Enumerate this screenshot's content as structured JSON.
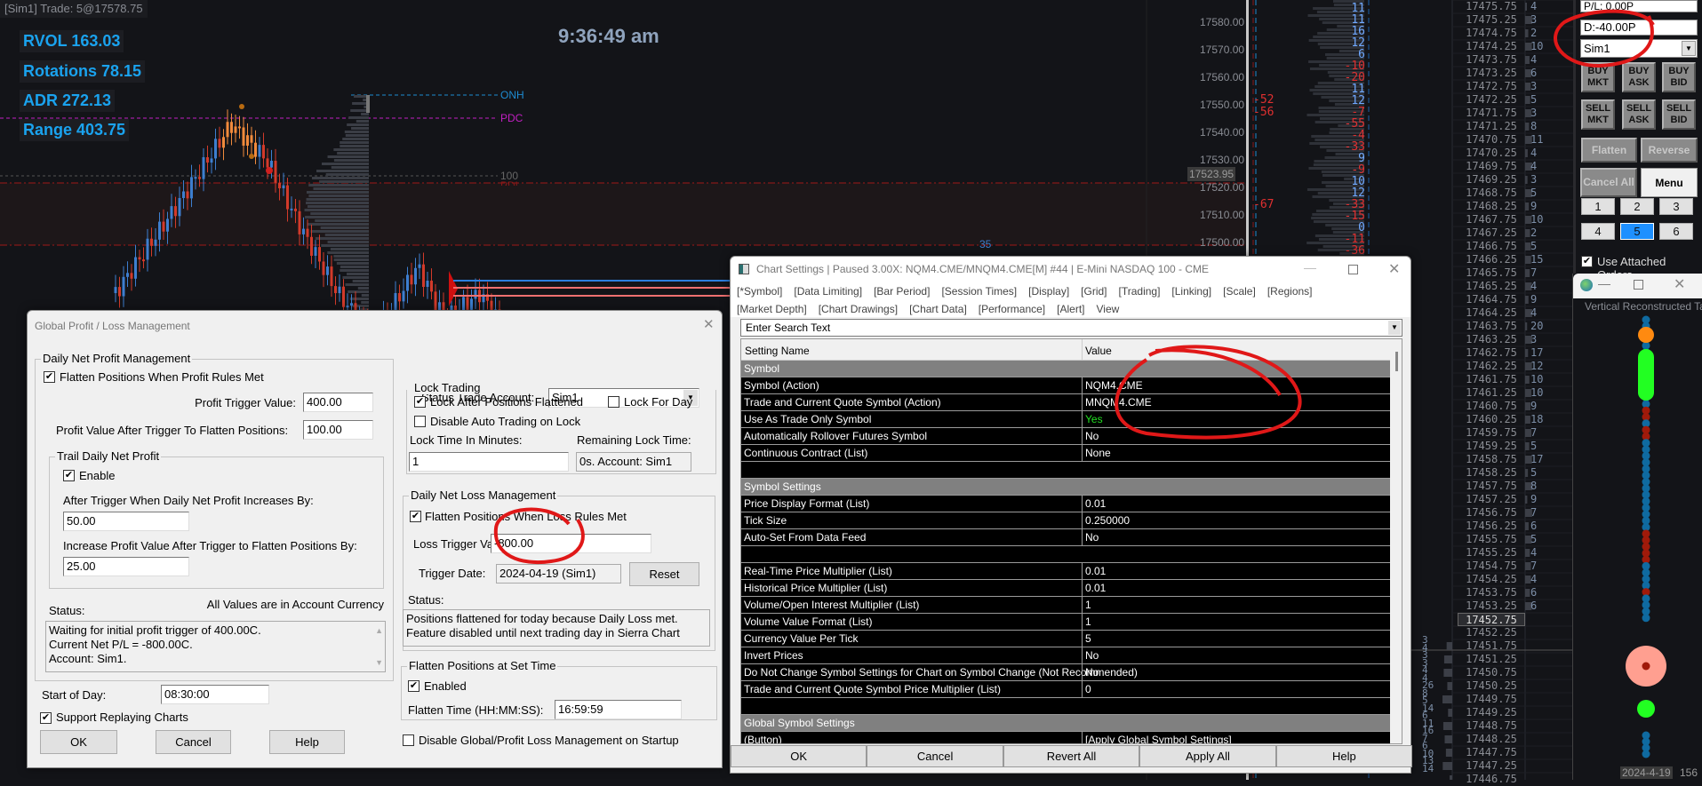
{
  "chart": {
    "top_label": "[Sim1]  Trade: 5@17578.75",
    "stats": [
      "RVOL 163.03",
      "Rotations 78.15",
      "ADR 272.13",
      "Range 403.75"
    ],
    "clock": "9:36:49 am",
    "levels": {
      "onh": "ONH",
      "pdc": "PDC",
      "hundred": "100",
      "pdl": "PDL"
    },
    "marker_label": "35",
    "price_axis": [
      "17580.00",
      "17570.00",
      "17560.00",
      "17550.00",
      "17540.00",
      "17530.00",
      "17520.00",
      "17510.00",
      "17500.00"
    ],
    "current_price": "17523.95",
    "colors": {
      "up": "#3d7ecf",
      "down": "#d23a2a",
      "peak": "#f08a3c",
      "stat": "#1aa3ef"
    }
  },
  "dom": {
    "left_deltas": [
      "-52",
      "-56",
      "-67"
    ],
    "deltas": [
      {
        "v": "11",
        "c": "#6fa8ff"
      },
      {
        "v": "11",
        "c": "#6fa8ff"
      },
      {
        "v": "16",
        "c": "#6fa8ff"
      },
      {
        "v": "12",
        "c": "#6fa8ff"
      },
      {
        "v": "6",
        "c": "#6fa8ff"
      },
      {
        "v": "-10",
        "c": "#e03030"
      },
      {
        "v": "-20",
        "c": "#e03030"
      },
      {
        "v": "11",
        "c": "#6fa8ff"
      },
      {
        "v": "12",
        "c": "#6fa8ff"
      },
      {
        "v": "-7",
        "c": "#e03030"
      },
      {
        "v": "-55",
        "c": "#e03030"
      },
      {
        "v": "-4",
        "c": "#e03030"
      },
      {
        "v": "-33",
        "c": "#e03030"
      },
      {
        "v": "9",
        "c": "#6fa8ff"
      },
      {
        "v": "-9",
        "c": "#e03030"
      },
      {
        "v": "10",
        "c": "#6fa8ff"
      },
      {
        "v": "12",
        "c": "#6fa8ff"
      },
      {
        "v": "-33",
        "c": "#e03030"
      },
      {
        "v": "-15",
        "c": "#e03030"
      },
      {
        "v": "0",
        "c": "#6fa8ff"
      },
      {
        "v": "-11",
        "c": "#e03030"
      },
      {
        "v": "-36",
        "c": "#e03030"
      }
    ],
    "lower_volumes": [
      "3",
      "4",
      "3",
      "3",
      "4",
      "4",
      "26",
      "8",
      "5",
      "14",
      "6",
      "11",
      "16",
      "7",
      "6",
      "10",
      "13",
      "14"
    ]
  },
  "ladder": {
    "prices": [
      "17475.75",
      "17475.25",
      "17474.75",
      "17474.25",
      "17473.75",
      "17473.25",
      "17472.75",
      "17472.25",
      "17471.75",
      "17471.25",
      "17470.75",
      "17470.25",
      "17469.75",
      "17469.25",
      "17468.75",
      "17468.25",
      "17467.75",
      "17467.25",
      "17466.75",
      "17466.25",
      "17465.75",
      "17465.25",
      "17464.75",
      "17464.25",
      "17463.75",
      "17463.25",
      "17462.75",
      "17462.25",
      "17461.75",
      "17461.25",
      "17460.75",
      "17460.25",
      "17459.75",
      "17459.25",
      "17458.75",
      "17458.25",
      "17457.75",
      "17457.25",
      "17456.75",
      "17456.25",
      "17455.75",
      "17455.25",
      "17454.75",
      "17454.25",
      "17453.75",
      "17453.25",
      "17452.75",
      "17452.25",
      "17451.75",
      "17451.25",
      "17450.75",
      "17450.25",
      "17449.75",
      "17449.25",
      "17448.75",
      "17448.25",
      "17447.75",
      "17447.25",
      "17446.75"
    ],
    "current_index": 46,
    "volumes": [
      "4",
      "3",
      "2",
      "10",
      "4",
      "6",
      "3",
      "5",
      "3",
      "8",
      "11",
      "4",
      "4",
      "3",
      "5",
      "9",
      "10",
      "2",
      "5",
      "15",
      "7",
      "4",
      "9",
      "4",
      "20",
      "3",
      "17",
      "12",
      "10",
      "10",
      "9",
      "18",
      "7",
      "5",
      "17",
      "5",
      "8",
      "9",
      "7",
      "6",
      "5",
      "4",
      "7",
      "4",
      "6",
      "6"
    ]
  },
  "trade_panel": {
    "pl": "P/L: 0.00P",
    "daily": "D:-40.00P",
    "account": "Sim1",
    "buy_mkt": "BUY MKT",
    "buy_ask": "BUY ASK",
    "buy_bid": "BUY BID",
    "sell_mkt": "SELL MKT",
    "sell_ask": "SELL ASK",
    "sell_bid": "SELL BID",
    "flatten": "Flatten",
    "reverse": "Reverse",
    "cancel_all": "Cancel All",
    "menu": "Menu",
    "qty": [
      "1",
      "2",
      "3",
      "4",
      "5",
      "6"
    ],
    "selected_qty": "5",
    "use_attached": "Use Attached Orders",
    "accent": "#1e90ff"
  },
  "tape": {
    "title": "Vertical Reconstructed Ta",
    "date": "2024-4-19",
    "count": "156"
  },
  "pl_dialog": {
    "title": "Global Profit / Loss Management",
    "profit_group": "Daily Net Profit Management",
    "flatten_profit": "Flatten Positions When Profit Rules Met",
    "profit_trigger_label": "Profit Trigger Value:",
    "profit_trigger": "400.00",
    "profit_after_label": "Profit Value After Trigger To Flatten Positions:",
    "profit_after": "100.00",
    "trail_group": "Trail Daily Net Profit",
    "enable": "Enable",
    "increase_by_label": "After Trigger When Daily Net Profit Increases By:",
    "increase_by": "50.00",
    "increase_value_label": "Increase Profit Value After Trigger to Flatten Positions By:",
    "increase_value": "25.00",
    "status_label": "Status:",
    "currency_note": "All Values are in Account Currency",
    "status_lines": [
      "Waiting for initial profit trigger of 400.00C.",
      "Current Net P/L = -800.00C.",
      "Account: Sim1."
    ],
    "start_label": "Start of Day:",
    "start": "08:30:00",
    "support_replay": "Support Replaying Charts",
    "ok": "OK",
    "cancel": "Cancel",
    "help": "Help",
    "status_account_label": "Status Trade Account:",
    "status_account": "Sim1",
    "lock_group": "Lock Trading",
    "lock_after": "Lock After Positions Flattened",
    "lock_day": "Lock For Day",
    "disable_auto": "Disable Auto Trading on Lock",
    "lock_time_label": "Lock Time In Minutes:",
    "lock_time": "1",
    "remaining_label": "Remaining Lock Time:",
    "remaining": "0s. Account: Sim1",
    "loss_group": "Daily Net Loss Management",
    "flatten_loss": "Flatten Positions When Loss Rules Met",
    "loss_trigger_label": "Loss Trigger Value:",
    "loss_trigger": "-800.00",
    "trigger_date_label": "Trigger Date:",
    "trigger_date": "2024-04-19 (Sim1)",
    "reset": "Reset",
    "loss_status_label": "Status:",
    "loss_status_lines": [
      "Positions flattened for today because Daily Loss met.",
      "Feature disabled until next trading day in Sierra Chart"
    ],
    "set_time_group": "Flatten Positions at Set Time",
    "enabled": "Enabled",
    "flatten_time_label": "Flatten Time (HH:MM:SS):",
    "flatten_time": "16:59:59",
    "disable_startup": "Disable Global/Profit Loss Management on Startup"
  },
  "cs_dialog": {
    "title": "Chart Settings | Paused 3.00X: NQM4.CME/MNQM4.CME[M] #44 | E-Mini NASDAQ 100 - CME",
    "tabs_row1": [
      "[*Symbol]",
      "[Data Limiting]",
      "[Bar Period]",
      "[Session Times]",
      "[Display]",
      "[Grid]",
      "[Trading]",
      "[Linking]",
      "[Scale]",
      "[Regions]"
    ],
    "tabs_row2": [
      "[Market Depth]",
      "[Chart Drawings]",
      "[Chart Data]",
      "[Performance]",
      "[Alert]",
      "View"
    ],
    "search_placeholder": "Enter Search Text",
    "col_name": "Setting Name",
    "col_value": "Value",
    "rows": [
      {
        "type": "group",
        "name": "Symbol",
        "value": ""
      },
      {
        "type": "row",
        "name": "Symbol (Action)",
        "value": "NQM4.CME"
      },
      {
        "type": "row",
        "name": "Trade and Current Quote Symbol (Action)",
        "value": "MNQM4.CME"
      },
      {
        "type": "row",
        "name": "Use As Trade Only Symbol",
        "value": "Yes",
        "color": "#22e022"
      },
      {
        "type": "row",
        "name": "Automatically Rollover Futures Symbol",
        "value": "No"
      },
      {
        "type": "row",
        "name": "Continuous Contract (List)",
        "value": "None"
      },
      {
        "type": "blank",
        "name": "",
        "value": ""
      },
      {
        "type": "group",
        "name": "Symbol Settings",
        "value": ""
      },
      {
        "type": "row",
        "name": "Price Display Format (List)",
        "value": "0.01"
      },
      {
        "type": "row",
        "name": "Tick Size",
        "value": "0.250000"
      },
      {
        "type": "row",
        "name": "Auto-Set From Data Feed",
        "value": "No"
      },
      {
        "type": "blank",
        "name": "",
        "value": ""
      },
      {
        "type": "row",
        "name": "Real-Time Price Multiplier (List)",
        "value": "0.01"
      },
      {
        "type": "row",
        "name": "Historical Price Multiplier (List)",
        "value": "0.01"
      },
      {
        "type": "row",
        "name": "Volume/Open Interest Multiplier (List)",
        "value": "1"
      },
      {
        "type": "row",
        "name": "Volume Value Format (List)",
        "value": "1"
      },
      {
        "type": "row",
        "name": "Currency Value Per Tick",
        "value": "5"
      },
      {
        "type": "row",
        "name": "Invert Prices",
        "value": "No"
      },
      {
        "type": "row",
        "name": "Do Not Change Symbol Settings for Chart on Symbol Change (Not Recommended)",
        "value": "No"
      },
      {
        "type": "row",
        "name": "Trade and Current Quote Symbol Price Multiplier (List)",
        "value": "0"
      },
      {
        "type": "blank",
        "name": "",
        "value": ""
      },
      {
        "type": "group",
        "name": "Global Symbol Settings",
        "value": ""
      },
      {
        "type": "row",
        "name": " (Button)",
        "value": "[Apply Global Symbol Settings]"
      }
    ],
    "ok": "OK",
    "cancel": "Cancel",
    "revert": "Revert All",
    "apply": "Apply All",
    "help": "Help"
  }
}
